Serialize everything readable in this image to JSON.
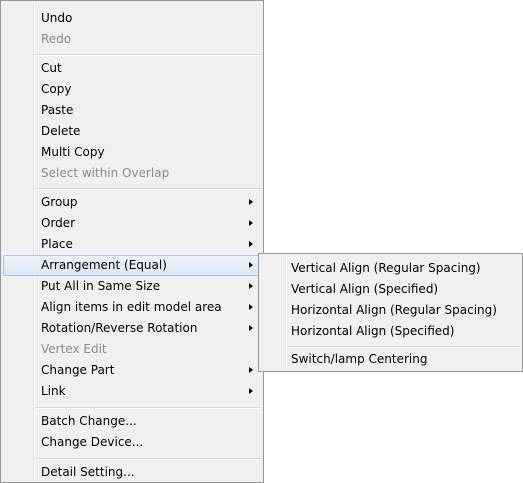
{
  "main_menu": {
    "items": [
      {
        "label": "Undo",
        "disabled": false,
        "submenu": false
      },
      {
        "label": "Redo",
        "disabled": true,
        "submenu": false
      },
      {
        "label": "Cut",
        "disabled": false,
        "submenu": false
      },
      {
        "label": "Copy",
        "disabled": false,
        "submenu": false
      },
      {
        "label": "Paste",
        "disabled": false,
        "submenu": false
      },
      {
        "label": "Delete",
        "disabled": false,
        "submenu": false
      },
      {
        "label": "Multi Copy",
        "disabled": false,
        "submenu": false
      },
      {
        "label": "Select within Overlap",
        "disabled": true,
        "submenu": false
      },
      {
        "label": "Group",
        "disabled": false,
        "submenu": true
      },
      {
        "label": "Order",
        "disabled": false,
        "submenu": true
      },
      {
        "label": "Place",
        "disabled": false,
        "submenu": true
      },
      {
        "label": "Arrangement (Equal)",
        "disabled": false,
        "submenu": true,
        "highlighted": true
      },
      {
        "label": "Put All in Same Size",
        "disabled": false,
        "submenu": true
      },
      {
        "label": "Align items in edit model area",
        "disabled": false,
        "submenu": true
      },
      {
        "label": "Rotation/Reverse Rotation",
        "disabled": false,
        "submenu": true
      },
      {
        "label": "Vertex Edit",
        "disabled": true,
        "submenu": false
      },
      {
        "label": "Change Part",
        "disabled": false,
        "submenu": true
      },
      {
        "label": "Link",
        "disabled": false,
        "submenu": true
      },
      {
        "label": "Batch Change...",
        "disabled": false,
        "submenu": false
      },
      {
        "label": "Change Device...",
        "disabled": false,
        "submenu": false
      },
      {
        "label": "Detail Setting...",
        "disabled": false,
        "submenu": false
      }
    ]
  },
  "sub_menu": {
    "items": [
      {
        "label": "Vertical Align (Regular Spacing)"
      },
      {
        "label": "Vertical Align (Specified)"
      },
      {
        "label": "Horizontal Align (Regular Spacing)"
      },
      {
        "label": "Horizontal Align (Specified)"
      },
      {
        "label": "Switch/lamp Centering"
      }
    ]
  },
  "colors": {
    "menu_background": "#f0f0f0",
    "menu_border": "#979797",
    "highlight_border": "#a9c7ec",
    "disabled_text": "#8b8b8b"
  },
  "icons": {
    "submenu_arrow": "chevron-right-icon"
  }
}
